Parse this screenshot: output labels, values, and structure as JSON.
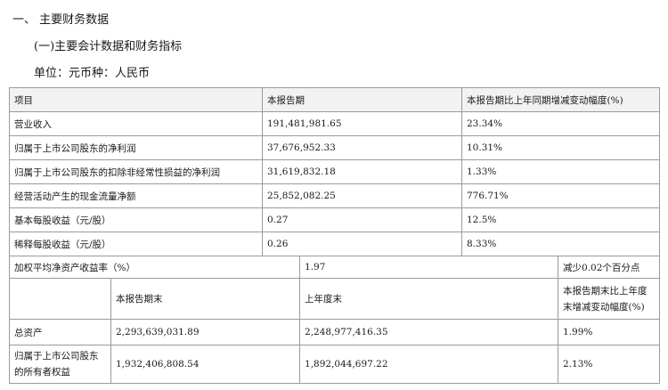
{
  "headings": {
    "section": "一、 主要财务数据",
    "subsection": "(一)主要会计数据和财务指标",
    "unit": "单位：元币种：人民币"
  },
  "table1": {
    "headers": [
      "项目",
      "本报告期",
      "本报告期比上年同期增减变动幅度(%)"
    ],
    "rows": [
      [
        "营业收入",
        "191,481,981.65",
        "23.34%"
      ],
      [
        "归属于上市公司股东的净利润",
        "37,676,952.33",
        "10.31%"
      ],
      [
        "归属于上市公司股东的扣除非经常性损益的净利润",
        "31,619,832.18",
        "1.33%"
      ],
      [
        "经营活动产生的现金流量净额",
        "25,852,082.25",
        "776.71%"
      ],
      [
        "基本每股收益（元/股）",
        "0.27",
        "12.5%"
      ],
      [
        "稀释每股收益（元/股）",
        "0.26",
        "8.33%"
      ]
    ]
  },
  "table2": {
    "roe": {
      "label": "加权平均净资产收益率（%）",
      "value": "1.97",
      "change": "减少0.02个百分点"
    },
    "headers": [
      "",
      "本报告期末",
      "上年度末",
      "本报告期末比上年度末增减变动幅度(%)"
    ],
    "rows": [
      [
        "总资产",
        "2,293,639,031.89",
        "2,248,977,416.35",
        "1.99%"
      ],
      [
        "归属于上市公司股东的所有者权益",
        "1,932,406,808.54",
        "1,892,044,697.22",
        "2.13%"
      ]
    ]
  }
}
